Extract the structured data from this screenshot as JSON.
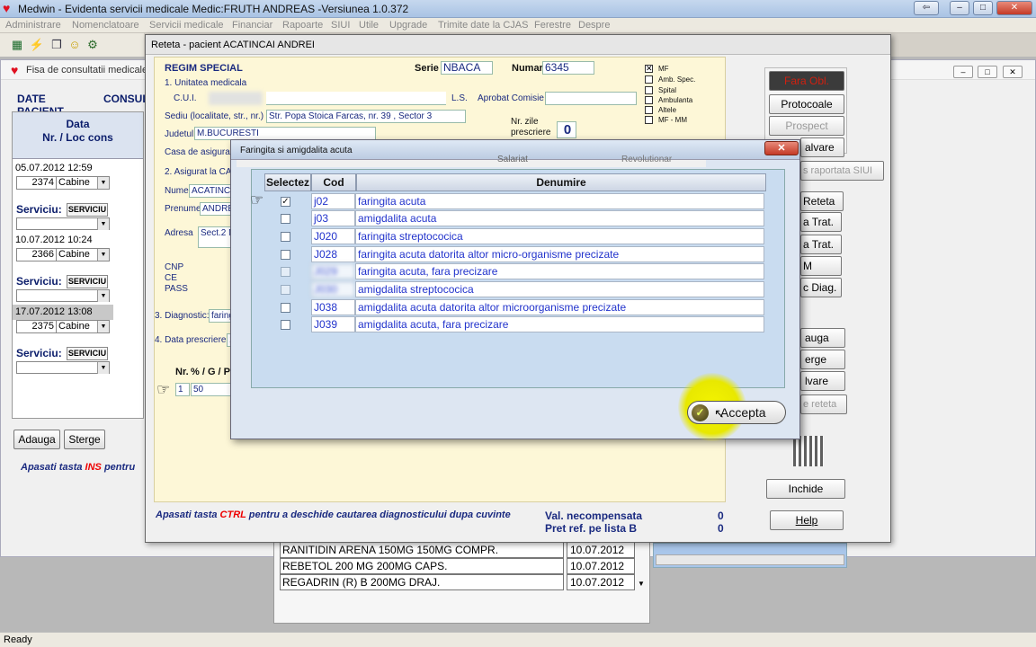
{
  "app": {
    "title": "Medwin - Evidenta servicii medicale    Medic:FRUTH ANDREAS -Versiunea 1.0.372",
    "window_controls": [
      "⇦",
      "–",
      "□",
      "✕"
    ]
  },
  "menu": [
    "Administrare",
    "Nomenclatoare",
    "Servicii medicale",
    "Financiar",
    "Rapoarte",
    "SIUI",
    "Utile",
    "Upgrade",
    "Trimite date la CJAS",
    "Ferestre",
    "Despre"
  ],
  "fisa": {
    "title": "Fisa de consultatii medicale",
    "tabs": [
      "DATE PACIENT",
      "CONSUL"
    ],
    "col_header_line1": "Data",
    "col_header_line2": "Nr. / Loc cons",
    "entries": [
      {
        "date": "05.07.2012 12:59",
        "nr": "2374",
        "loc": "Cabine"
      },
      {
        "date": "10.07.2012 10:24",
        "nr": "2366",
        "loc": "Cabine"
      },
      {
        "date": "17.07.2012 13:08",
        "nr": "2375",
        "loc": "Cabine"
      }
    ],
    "serviciu_label": "Serviciu:",
    "serviciu_button": "SERVICIU",
    "hint_prefix": "Apasati tasta",
    "hint_key": "INS",
    "hint_suffix": "pentru",
    "add_button": "Adauga",
    "delete_button": "Sterge"
  },
  "reteta": {
    "title": "Reteta - pacient ACATINCAI ANDREI",
    "regim": "REGIM SPECIAL",
    "serie_label": "Serie",
    "serie_value": "NBACA",
    "numar_label": "Numar",
    "numar_value": "6345",
    "unitate_label": "1. Unitatea medicala",
    "cui_label": "C.U.I.",
    "ls_label": "L.S.",
    "aprobat_label": "Aprobat Comisie",
    "sediu_label": "Sediu (localitate, str., nr.)",
    "sediu_value": "Str. Popa Stoica Farcas, nr. 39 , Sector 3",
    "nr_zile_label": "Nr. zile",
    "prescriere_label": "prescriere",
    "nr_zile_value": "0",
    "judetul_label": "Judetul",
    "judetul_value": "M.BUCURESTI",
    "casa_label": "Casa de asigurari",
    "asigurat_label": "2. Asigurat la CAS:",
    "salariat_label": "Salariat",
    "revolutionar_label": "Revolutionar",
    "nume_label": "Nume",
    "nume_value": "ACATINCAI",
    "prenume_label": "Prenume",
    "prenume_value": "ANDREI",
    "adresa_label": "Adresa",
    "adresa_value": "Sect.2 M",
    "cnp_label": "CNP",
    "ce_label": "CE",
    "pass_label": "PASS",
    "diag_label": "3. Diagnostic:",
    "diag_value": "faring",
    "data_presc_label": "4. Data prescriere",
    "data_presc_value": "17",
    "nr_label": "Nr.",
    "pgp_label": "% / G / P",
    "row_nr": "1",
    "row_pct": "50",
    "checkboxes": [
      {
        "label": "MF",
        "checked": true
      },
      {
        "label": "Amb. Spec.",
        "checked": false
      },
      {
        "label": "Spital",
        "checked": false
      },
      {
        "label": "Ambulanta",
        "checked": false
      },
      {
        "label": "Altele",
        "checked": false
      },
      {
        "label": "MF - MM",
        "checked": false
      }
    ],
    "right_buttons": {
      "fara_date": "Fara Obl.",
      "protocoale": "Protocoale",
      "prospect": "Prospect",
      "salvare": "alvare",
      "raportata": "s raportata SIUI",
      "reteta": "Reteta",
      "trat1": "a Trat.",
      "trat2": "a Trat.",
      "m": "M",
      "diag": "c Diag.",
      "adauga": "auga",
      "sterge": "erge",
      "salvare2": "lvare",
      "sterge_reteta": "e reteta",
      "inchide": "Inchide",
      "help": "Help"
    },
    "footer_hint_prefix": "Apasati tasta",
    "footer_hint_key": "CTRL",
    "footer_hint_suffix": "pentru a deschide cautarea diagnosticului dupa cuvinte",
    "val_necomp_label": "Val. necompensata",
    "val_necomp_value": "0",
    "pret_ref_label": "Pret ref. pe lista B",
    "pret_ref_value": "0"
  },
  "dialog": {
    "title": "Faringita si amigdalita acuta",
    "close": "✕",
    "columns": [
      "Selectez",
      "Cod",
      "Denumire"
    ],
    "rows": [
      {
        "checked": true,
        "cod": "j02",
        "denumire": "faringita acuta"
      },
      {
        "checked": false,
        "cod": "j03",
        "denumire": "amigdalita acuta"
      },
      {
        "checked": false,
        "cod": "J020",
        "denumire": "faringita streptococica"
      },
      {
        "checked": false,
        "cod": "J028",
        "denumire": "faringita acuta datorita altor micro-organisme precizate"
      },
      {
        "checked": false,
        "cod": "J029",
        "denumire": "faringita acuta, fara precizare"
      },
      {
        "checked": false,
        "cod": "J030",
        "denumire": "amigdalita streptococica"
      },
      {
        "checked": false,
        "cod": "J038",
        "denumire": "amigdalita acuta datorita altor microorganisme precizate"
      },
      {
        "checked": false,
        "cod": "J039",
        "denumire": "amigdalita acuta, fara precizare"
      }
    ],
    "accept_label": "Accepta"
  },
  "medications": [
    {
      "name": "RANITIDIN  ARENA 150MG 150MG COMPR.",
      "date": "10.07.2012"
    },
    {
      "name": "REBETOL 200 MG 200MG CAPS.",
      "date": "10.07.2012"
    },
    {
      "name": "REGADRIN (R) B 200MG DRAJ.",
      "date": "10.07.2012"
    }
  ],
  "status": "Ready"
}
